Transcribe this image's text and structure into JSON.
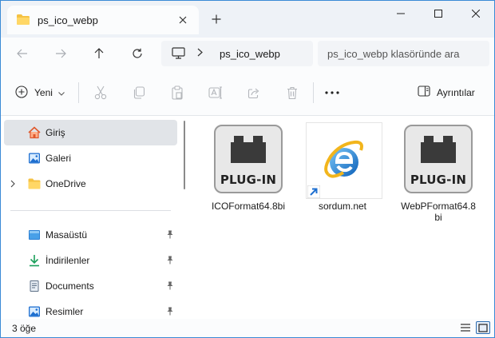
{
  "window": {
    "tab_title": "ps_ico_webp",
    "colors": {
      "accent": "#0067c0",
      "folder": "#f5c243",
      "border": "#3a8ad6"
    }
  },
  "address": {
    "crumb": "ps_ico_webp",
    "search_placeholder": "ps_ico_webp klasöründe ara"
  },
  "toolbar": {
    "new_label": "Yeni",
    "details_label": "Ayrıntılar"
  },
  "sidebar": {
    "items": [
      {
        "label": "Giriş",
        "icon": "home-icon",
        "selected": true
      },
      {
        "label": "Galeri",
        "icon": "gallery-icon"
      },
      {
        "label": "OneDrive",
        "icon": "folder-icon",
        "expandable": true
      },
      {
        "label": "Masaüstü",
        "icon": "desktop-icon",
        "pinned": true
      },
      {
        "label": "İndirilenler",
        "icon": "download-icon",
        "pinned": true
      },
      {
        "label": "Documents",
        "icon": "document-icon",
        "pinned": true
      },
      {
        "label": "Resimler",
        "icon": "pictures-icon",
        "pinned": true
      }
    ]
  },
  "files": [
    {
      "name": "ICOFormat64.8bi",
      "icon": "plugin-icon",
      "badge": "PLUG-IN"
    },
    {
      "name": "sordum.net",
      "icon": "internet-explorer-icon",
      "shortcut": true
    },
    {
      "name": "WebPFormat64.8bi",
      "icon": "plugin-icon",
      "badge": "PLUG-IN"
    }
  ],
  "status": {
    "count": "3 öğe"
  }
}
